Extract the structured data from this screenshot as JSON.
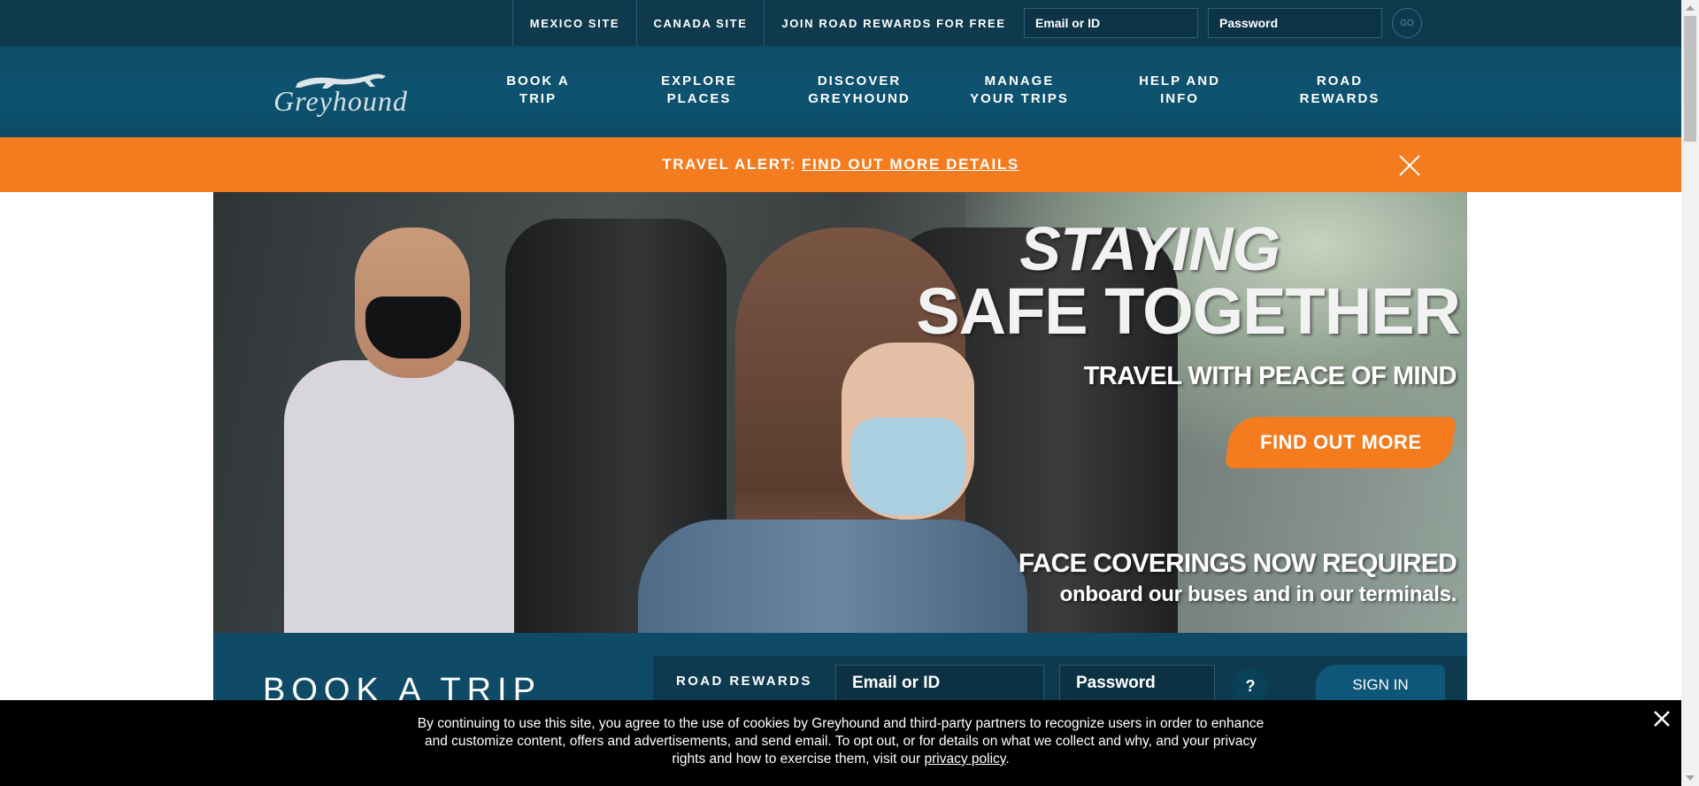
{
  "topbar": {
    "mexico_site": "MEXICO SITE",
    "canada_site": "CANADA SITE",
    "join": "JOIN ROAD REWARDS FOR FREE",
    "email_placeholder": "Email or ID",
    "password_placeholder": "Password",
    "go": "GO"
  },
  "logo": {
    "text": "Greyhound"
  },
  "nav": {
    "items": [
      {
        "line1": "BOOK A",
        "line2": "TRIP"
      },
      {
        "line1": "EXPLORE",
        "line2": "PLACES"
      },
      {
        "line1": "DISCOVER",
        "line2": "GREYHOUND"
      },
      {
        "line1": "MANAGE",
        "line2": "YOUR TRIPS"
      },
      {
        "line1": "HELP AND",
        "line2": "INFO"
      },
      {
        "line1": "ROAD",
        "line2": "REWARDS"
      }
    ]
  },
  "alert": {
    "label": "TRAVEL ALERT:",
    "link": "FIND OUT MORE DETAILS"
  },
  "hero": {
    "line1": "STAYING",
    "line2": "SAFE TOGETHER",
    "line3": "TRAVEL WITH PEACE OF MIND",
    "button": "FIND OUT MORE",
    "line4": "FACE COVERINGS NOW REQUIRED",
    "line5": "onboard our buses and in our terminals."
  },
  "booking": {
    "title": "BOOK A TRIP",
    "rr_label": "ROAD REWARDS",
    "email_placeholder": "Email or ID",
    "password_placeholder": "Password",
    "help": "?",
    "signin": "SIGN IN"
  },
  "cookie": {
    "text": "By continuing to use this site, you agree to the use of cookies by Greyhound and third-party partners to recognize users in order to enhance and customize content, offers and advertisements, and send email. To opt out, or for details on what we collect and why, and your privacy rights and how to exercise them, visit our",
    "link": "privacy policy",
    "end": "."
  },
  "colors": {
    "topbar": "#0f3a4e",
    "nav": "#0d5370",
    "alert": "#f47b1e",
    "cookie": "#000000"
  },
  "icons": {
    "alert_close": "close-icon",
    "cookie_close": "close-icon",
    "logo": "greyhound-dog-icon"
  }
}
